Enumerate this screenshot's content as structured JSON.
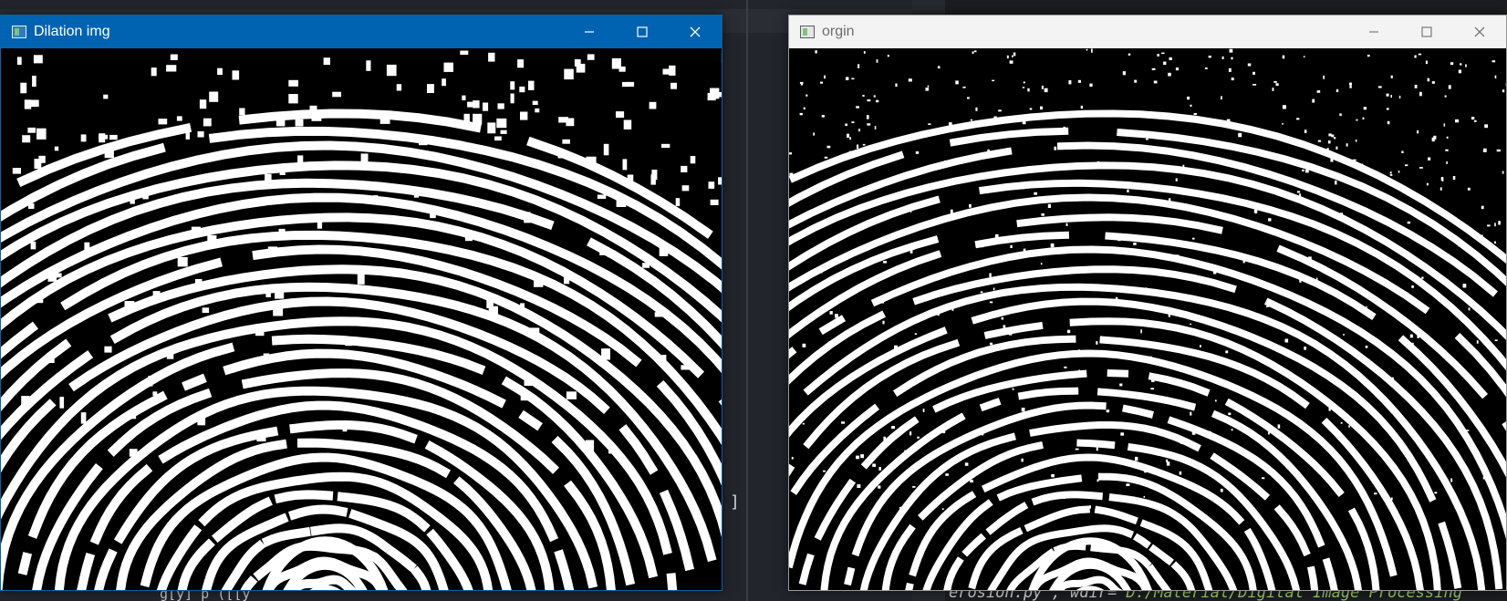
{
  "windows": [
    {
      "id": "dilation",
      "title": "Dilation img",
      "active": true,
      "image_label": "fingerprint-dilated",
      "noise": "coarse"
    },
    {
      "id": "origin",
      "title": "orgin",
      "active": false,
      "image_label": "fingerprint-original",
      "noise": "fine"
    }
  ],
  "controls": {
    "minimize_icon": "minimize-icon",
    "maximize_icon": "maximize-icon",
    "close_icon": "close-icon"
  },
  "background_code": {
    "bottom_right_prefix": "erosion.py', wdir=",
    "bottom_right_path": "'D:/Material/Digital Image Processing",
    "bottom_left": "_g[y]  p  ([[y_",
    "bracket": "]"
  },
  "colors": {
    "active_titlebar": "#0063b1",
    "inactive_titlebar": "#f3f3f3",
    "ridge": "#ffffff",
    "valley": "#000000"
  }
}
